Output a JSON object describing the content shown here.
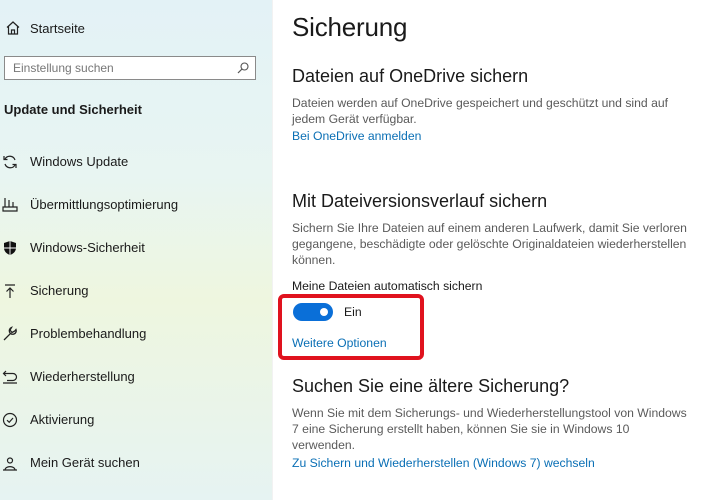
{
  "sidebar": {
    "home_label": "Startseite",
    "search_placeholder": "Einstellung suchen",
    "section_title": "Update und Sicherheit",
    "items": [
      {
        "label": "Windows Update",
        "icon": "sync-icon"
      },
      {
        "label": "Übermittlungsoptimierung",
        "icon": "delivery-icon"
      },
      {
        "label": "Windows-Sicherheit",
        "icon": "shield-icon"
      },
      {
        "label": "Sicherung",
        "icon": "backup-arrow-icon"
      },
      {
        "label": "Problembehandlung",
        "icon": "wrench-icon"
      },
      {
        "label": "Wiederherstellung",
        "icon": "recovery-icon"
      },
      {
        "label": "Aktivierung",
        "icon": "check-circle-icon"
      },
      {
        "label": "Mein Gerät suchen",
        "icon": "location-person-icon"
      }
    ]
  },
  "main": {
    "page_title": "Sicherung",
    "onedrive": {
      "heading": "Dateien auf OneDrive sichern",
      "description": "Dateien werden auf OneDrive gespeichert und geschützt und sind auf jedem Gerät verfügbar.",
      "link": "Bei OneDrive anmelden"
    },
    "file_history": {
      "heading": "Mit Dateiversionsverlauf sichern",
      "description": "Sichern Sie Ihre Dateien auf einem anderen Laufwerk, damit Sie verloren gegangene, beschädigte oder gelöschte Originaldateien wiederherstellen können.",
      "toggle_label": "Meine Dateien automatisch sichern",
      "toggle_state": "Ein",
      "toggle_on": true,
      "more_options": "Weitere Optionen"
    },
    "older_backup": {
      "heading": "Suchen Sie eine ältere Sicherung?",
      "description": "Wenn Sie mit dem Sicherungs- und Wiederherstellungstool von Windows 7 eine Sicherung erstellt haben, können Sie sie in Windows 10 verwenden.",
      "link": "Zu Sichern und Wiederherstellen (Windows 7) wechseln"
    }
  },
  "colors": {
    "accent": "#0a6fd8",
    "link": "#0a6fb5",
    "highlight": "#e0121e"
  }
}
